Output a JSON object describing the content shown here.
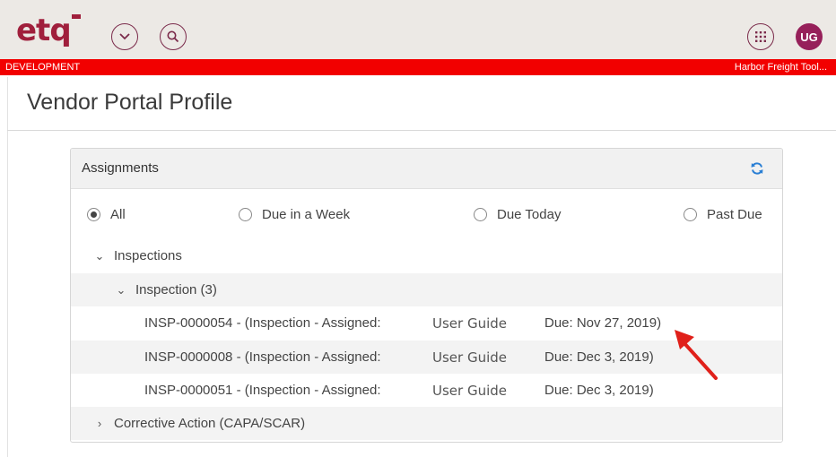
{
  "app": {
    "logo": "etq",
    "user_initials": "UG",
    "environment": "DEVELOPMENT",
    "organization": "Harbor Freight Tool..."
  },
  "page": {
    "title": "Vendor Portal Profile"
  },
  "assignments": {
    "title": "Assignments",
    "filters": [
      {
        "label": "All",
        "selected": true
      },
      {
        "label": "Due in a Week",
        "selected": false
      },
      {
        "label": "Due Today",
        "selected": false
      },
      {
        "label": "Past Due",
        "selected": false
      }
    ],
    "tree": {
      "inspections_label": "Inspections",
      "inspection_group_label": "Inspection (3)",
      "items": [
        {
          "id": "INSP-0000054 - (Inspection - Assigned:",
          "assignee": "User Guide",
          "due": "Due: Nov 27, 2019)"
        },
        {
          "id": "INSP-0000008 - (Inspection - Assigned:",
          "assignee": "User Guide",
          "due": "Due: Dec 3, 2019)"
        },
        {
          "id": "INSP-0000051 - (Inspection - Assigned:",
          "assignee": "User Guide",
          "due": "Due: Dec 3, 2019)"
        }
      ],
      "corrective_label": "Corrective Action (CAPA/SCAR)"
    }
  },
  "colors": {
    "brand": "#a01f3c",
    "env_bar": "#f20000",
    "avatar": "#96205a",
    "refresh": "#2a7fd4",
    "annotation_arrow": "#e0201a"
  },
  "icons": {
    "chevron": "chevron-down-icon",
    "search": "search-icon",
    "apps": "grid-icon",
    "refresh": "refresh-icon",
    "annotation": "red-arrow-icon"
  }
}
